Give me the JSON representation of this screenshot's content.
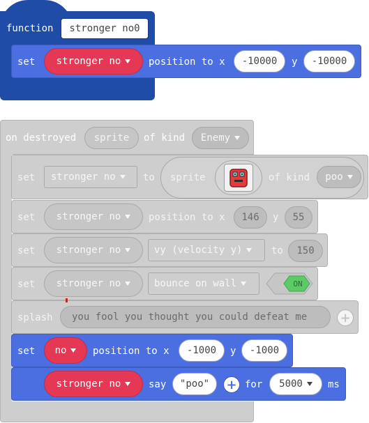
{
  "function_block": {
    "keyword": "function",
    "name": "stronger no0"
  },
  "blue_set_1": {
    "set": "set",
    "sprite": "stronger no",
    "mid": "position to x",
    "x": "-10000",
    "y_label": "y",
    "y": "-10000"
  },
  "event_block": {
    "prefix": "on destroyed",
    "sprite": "sprite",
    "mid": "of kind",
    "kind": "Enemy"
  },
  "row_set_var": {
    "set": "set",
    "var": "stronger no",
    "to": "to",
    "sprite_label": "sprite",
    "of_kind": "of kind",
    "kind": "poo"
  },
  "row_position": {
    "set": "set",
    "sprite": "stronger no",
    "mid": "position to x",
    "x": "146",
    "y_label": "y",
    "y": "55"
  },
  "row_velocity": {
    "set": "set",
    "sprite": "stronger no",
    "prop": "vy (velocity y)",
    "to": "to",
    "value": "150"
  },
  "row_bounce": {
    "set": "set",
    "sprite": "stronger no",
    "prop": "bounce on wall",
    "toggle": "ON"
  },
  "row_splash": {
    "label": "splash",
    "text": "you fool you thought you could defeat me"
  },
  "blue_set_2": {
    "set": "set",
    "sprite": "no",
    "mid": "position to x",
    "x": "-1000",
    "y_label": "y",
    "y": "-1000"
  },
  "blue_say": {
    "sprite": "stronger no",
    "say": "say",
    "text": "\"poo\"",
    "for": "for",
    "duration": "5000",
    "unit": "ms"
  },
  "colors": {
    "sprites_blue": "#4b6fe0",
    "functions_dark_blue": "#1f4ca6",
    "sprite_red": "#e53855",
    "disabled_grey": "#cecece",
    "toggle_green": "#5ccb66"
  }
}
